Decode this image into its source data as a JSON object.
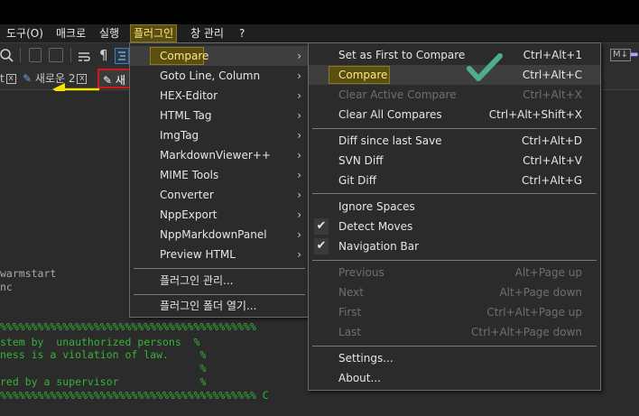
{
  "menubar": {
    "items": [
      "도구(O)",
      "매크로",
      "실행",
      "플러그인",
      "창 관리",
      "?"
    ]
  },
  "toolbar": {
    "icons": [
      "zoom-icon",
      "wrap-icon",
      "pilcrow-icon",
      "indent-guide-icon",
      "monitor-icon"
    ],
    "pilcrow": "¶",
    "right_badge": "M↓"
  },
  "tabs": [
    {
      "label": "t",
      "close": "x"
    },
    {
      "label": "새로운 2",
      "close": "x"
    },
    {
      "label": "새",
      "close": ""
    }
  ],
  "editor": {
    "lines": [
      {
        "text": "warmstart",
        "color": "w"
      },
      {
        "text": "nc",
        "color": "w"
      },
      {
        "text": "%%%%%%%%%%%%%%%%%%%%%%%%%%%%%%%%%%%%%%%%%",
        "color": "g"
      },
      {
        "text": "stem by  unauthorized persons  %",
        "color": "g"
      },
      {
        "text": "ness is a violation of law.     %",
        "color": "g"
      },
      {
        "text": "                                %",
        "color": "g"
      },
      {
        "text": "red by a supervisor             %",
        "color": "g"
      },
      {
        "text": "%%%%%%%%%%%%%%%%%%%%%%%%%%%%%%%%%%%%%%%%% C",
        "color": "g"
      }
    ]
  },
  "plugin_menu": {
    "items": [
      {
        "label": "Compare",
        "submenu": true,
        "highlighted": true
      },
      {
        "label": "Goto Line, Column",
        "submenu": true
      },
      {
        "label": "HEX-Editor",
        "submenu": true
      },
      {
        "label": "HTML Tag",
        "submenu": true
      },
      {
        "label": "ImgTag",
        "submenu": true
      },
      {
        "label": "MarkdownViewer++",
        "submenu": true
      },
      {
        "label": "MIME Tools",
        "submenu": true
      },
      {
        "label": "Converter",
        "submenu": true
      },
      {
        "label": "NppExport",
        "submenu": true
      },
      {
        "label": "NppMarkdownPanel",
        "submenu": true
      },
      {
        "label": "Preview HTML",
        "submenu": true
      }
    ],
    "manage": "플러그인 관리...",
    "open_folder": "플러그인 폴더 열기..."
  },
  "compare_menu": {
    "groups": [
      [
        {
          "label": "Set as First to Compare",
          "shortcut": "Ctrl+Alt+1"
        },
        {
          "label": "Compare",
          "shortcut": "Ctrl+Alt+C",
          "highlighted": true
        },
        {
          "label": "Clear Active Compare",
          "shortcut": "Ctrl+Alt+X",
          "disabled": true
        },
        {
          "label": "Clear All Compares",
          "shortcut": "Ctrl+Alt+Shift+X"
        }
      ],
      [
        {
          "label": "Diff since last Save",
          "shortcut": "Ctrl+Alt+D"
        },
        {
          "label": "SVN Diff",
          "shortcut": "Ctrl+Alt+V"
        },
        {
          "label": "Git Diff",
          "shortcut": "Ctrl+Alt+G"
        }
      ],
      [
        {
          "label": "Ignore Spaces",
          "shortcut": ""
        },
        {
          "label": "Detect Moves",
          "shortcut": "",
          "checked": true
        },
        {
          "label": "Navigation Bar",
          "shortcut": "",
          "checked": true
        }
      ],
      [
        {
          "label": "Previous",
          "shortcut": "Alt+Page up",
          "disabled": true
        },
        {
          "label": "Next",
          "shortcut": "Alt+Page down",
          "disabled": true
        },
        {
          "label": "First",
          "shortcut": "Ctrl+Alt+Page up",
          "disabled": true
        },
        {
          "label": "Last",
          "shortcut": "Ctrl+Alt+Page down",
          "disabled": true
        }
      ],
      [
        {
          "label": "Settings...",
          "shortcut": ""
        },
        {
          "label": "About...",
          "shortcut": ""
        }
      ]
    ]
  },
  "colors": {
    "highlight_bg": "#5a4f12",
    "highlight_text": "#ffe87a",
    "red_frame": "#d01818",
    "arrow_yellow": "#f5e400",
    "teal_check": "#4fae8a",
    "editor_green": "#35b535"
  }
}
